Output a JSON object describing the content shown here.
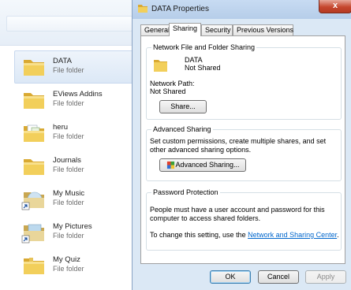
{
  "explorer": {
    "items": [
      {
        "name": "DATA",
        "type": "File folder",
        "icon": "folder-icon",
        "selected": true
      },
      {
        "name": "EViews Addins",
        "type": "File folder",
        "icon": "folder-icon"
      },
      {
        "name": "heru",
        "type": "File folder",
        "icon": "folder-with-files-icon"
      },
      {
        "name": "Journals",
        "type": "File folder",
        "icon": "folder-icon"
      },
      {
        "name": "My Music",
        "type": "File folder",
        "icon": "music-shortcut-icon"
      },
      {
        "name": "My Pictures",
        "type": "File folder",
        "icon": "pictures-shortcut-icon"
      },
      {
        "name": "My Quiz",
        "type": "File folder",
        "icon": "folder-icon"
      }
    ]
  },
  "dialog": {
    "title": "DATA Properties",
    "close_glyph": "x",
    "tabs": [
      {
        "label": "General",
        "active": false
      },
      {
        "label": "Sharing",
        "active": true
      },
      {
        "label": "Security",
        "active": false
      },
      {
        "label": "Previous Versions",
        "active": false
      }
    ],
    "network_sharing": {
      "group_title": "Network File and Folder Sharing",
      "folder_name": "DATA",
      "share_status": "Not Shared",
      "path_label": "Network Path:",
      "path_value": "Not Shared",
      "share_button": "Share..."
    },
    "advanced_sharing": {
      "group_title": "Advanced Sharing",
      "description": "Set custom permissions, create multiple shares, and set other advanced sharing options.",
      "button": "Advanced Sharing..."
    },
    "password_protection": {
      "group_title": "Password Protection",
      "description": "People must have a user account and password for this computer to access shared folders.",
      "change_text": "To change this setting, use the",
      "link_text": "Network and Sharing Center",
      "link_suffix": "."
    },
    "buttons": {
      "ok": "OK",
      "cancel": "Cancel",
      "apply": "Apply"
    }
  },
  "colors": {
    "dialog_bg": "#dbe8f5",
    "close_red": "#c6472f",
    "link_blue": "#0066cc",
    "folder_yellow": "#f2cf5b",
    "selection_blue": "#dce8f6"
  }
}
